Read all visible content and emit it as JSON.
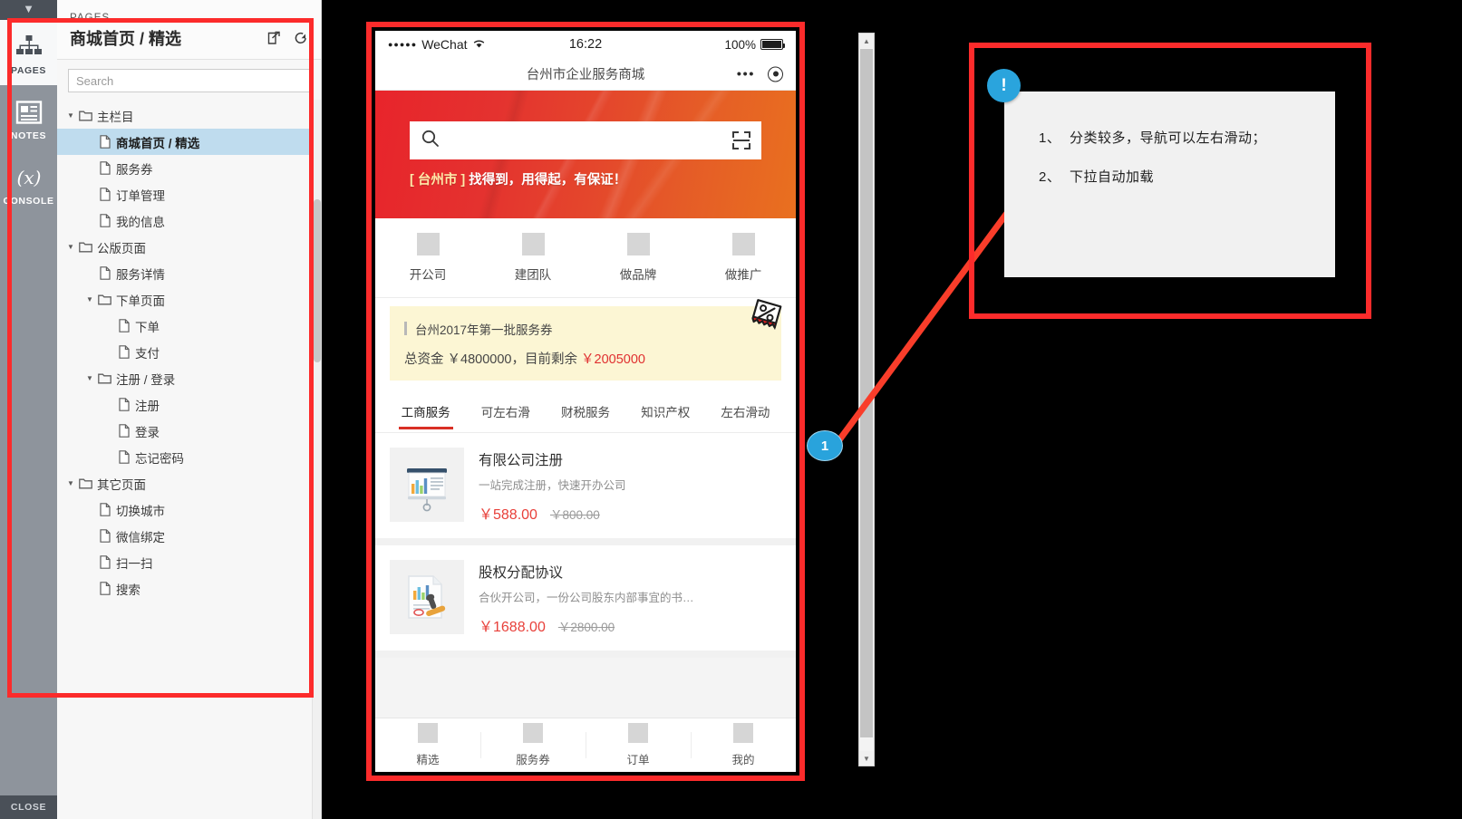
{
  "rail": {
    "items": [
      {
        "label": "PAGES",
        "icon": "sitemap-icon",
        "active": true
      },
      {
        "label": "NOTES",
        "icon": "notes-icon",
        "active": false
      },
      {
        "label": "CONSOLE",
        "icon": "console-x-icon",
        "active": false
      }
    ],
    "close_label": "CLOSE",
    "collapse_icon": "chevron-down-icon"
  },
  "pages_panel": {
    "eyebrow": "PAGES",
    "title": "商城首页 / 精选",
    "icons": {
      "open_external": "open-in-new-icon",
      "refresh": "reload-icon"
    },
    "search": {
      "value": "",
      "placeholder": "Search"
    },
    "tree": [
      {
        "depth": 0,
        "type": "folder",
        "caret": "▼",
        "label": "主栏目",
        "selected": false
      },
      {
        "depth": 1,
        "type": "page",
        "caret": "",
        "label": "商城首页 / 精选",
        "selected": true
      },
      {
        "depth": 1,
        "type": "page",
        "caret": "",
        "label": "服务券",
        "selected": false
      },
      {
        "depth": 1,
        "type": "page",
        "caret": "",
        "label": "订单管理",
        "selected": false
      },
      {
        "depth": 1,
        "type": "page",
        "caret": "",
        "label": "我的信息",
        "selected": false
      },
      {
        "depth": 0,
        "type": "folder",
        "caret": "▼",
        "label": "公版页面",
        "selected": false
      },
      {
        "depth": 1,
        "type": "page",
        "caret": "",
        "label": "服务详情",
        "selected": false
      },
      {
        "depth": 1,
        "type": "folder",
        "caret": "▼",
        "label": "下单页面",
        "selected": false
      },
      {
        "depth": 2,
        "type": "page",
        "caret": "",
        "label": "下单",
        "selected": false
      },
      {
        "depth": 2,
        "type": "page",
        "caret": "",
        "label": "支付",
        "selected": false
      },
      {
        "depth": 1,
        "type": "folder",
        "caret": "▼",
        "label": "注册 / 登录",
        "selected": false
      },
      {
        "depth": 2,
        "type": "page",
        "caret": "",
        "label": "注册",
        "selected": false
      },
      {
        "depth": 2,
        "type": "page",
        "caret": "",
        "label": "登录",
        "selected": false
      },
      {
        "depth": 2,
        "type": "page",
        "caret": "",
        "label": "忘记密码",
        "selected": false
      },
      {
        "depth": 0,
        "type": "folder",
        "caret": "▼",
        "label": "其它页面",
        "selected": false
      },
      {
        "depth": 1,
        "type": "page",
        "caret": "",
        "label": "切换城市",
        "selected": false
      },
      {
        "depth": 1,
        "type": "page",
        "caret": "",
        "label": "微信绑定",
        "selected": false
      },
      {
        "depth": 1,
        "type": "page",
        "caret": "",
        "label": "扫一扫",
        "selected": false
      },
      {
        "depth": 1,
        "type": "page",
        "caret": "",
        "label": "搜索",
        "selected": false
      }
    ]
  },
  "phone": {
    "status_bar": {
      "signal_dots": "●●●●●",
      "carrier": "WeChat",
      "wifi_icon": "wifi-icon",
      "time": "16:22",
      "battery_percent": "100%"
    },
    "wechat_nav": {
      "title": "台州市企业服务商城",
      "more_icon": "more-dots-icon",
      "target_icon": "target-circle-icon"
    },
    "hero": {
      "search_placeholder": "",
      "search_icon": "search-icon",
      "scan_icon": "scan-qr-icon",
      "slogan_city": "[ 台州市 ]",
      "slogan_rest": "找得到，用得起，有保证！",
      "gradient_from": "#e8242b",
      "gradient_to": "#e9701f"
    },
    "quicknav": [
      {
        "label": "开公司",
        "icon": "placeholder-image"
      },
      {
        "label": "建团队",
        "icon": "placeholder-image"
      },
      {
        "label": "做品牌",
        "icon": "placeholder-image"
      },
      {
        "label": "做推广",
        "icon": "placeholder-image"
      }
    ],
    "coupon": {
      "title": "台州2017年第一批服务券",
      "amount_prefix": "总资金 ￥4800000，目前剩余 ",
      "amount_remaining": "￥2005000",
      "badge_icon": "percent-ticket-icon",
      "bg_color": "#fcf6d4",
      "highlight_color": "#e03030"
    },
    "category_tabs": [
      {
        "label": "工商服务",
        "active": true
      },
      {
        "label": "可左右滑",
        "active": false
      },
      {
        "label": "财税服务",
        "active": false
      },
      {
        "label": "知识产权",
        "active": false
      },
      {
        "label": "左右滑动",
        "active": false
      }
    ],
    "products": [
      {
        "title": "有限公司注册",
        "desc": "一站完成注册，快速开办公司",
        "price": "￥588.00",
        "original_price": "￥800.00",
        "thumb_icon": "presentation-chart-icon"
      },
      {
        "title": "股权分配协议",
        "desc": "合伙开公司，一份公司股东内部事宜的书…",
        "price": "￥1688.00",
        "original_price": "￥2800.00",
        "thumb_icon": "document-stamp-icon"
      }
    ],
    "tabbar": [
      {
        "label": "精选",
        "icon": "placeholder-image"
      },
      {
        "label": "服务券",
        "icon": "placeholder-image"
      },
      {
        "label": "订单",
        "icon": "placeholder-image"
      },
      {
        "label": "我的",
        "icon": "placeholder-image"
      }
    ]
  },
  "scrollbar": {
    "up_arrow": "▲",
    "down_arrow": "▼"
  },
  "annotation": {
    "badge_symbol": "!",
    "badge_color": "#2aa4dd",
    "lines": [
      {
        "num": "1、",
        "text": "分类较多，导航可以左右滑动；"
      },
      {
        "num": "2、",
        "text": "下拉自动加载"
      }
    ]
  },
  "marker": {
    "label": "1",
    "color": "#29a3dc"
  }
}
